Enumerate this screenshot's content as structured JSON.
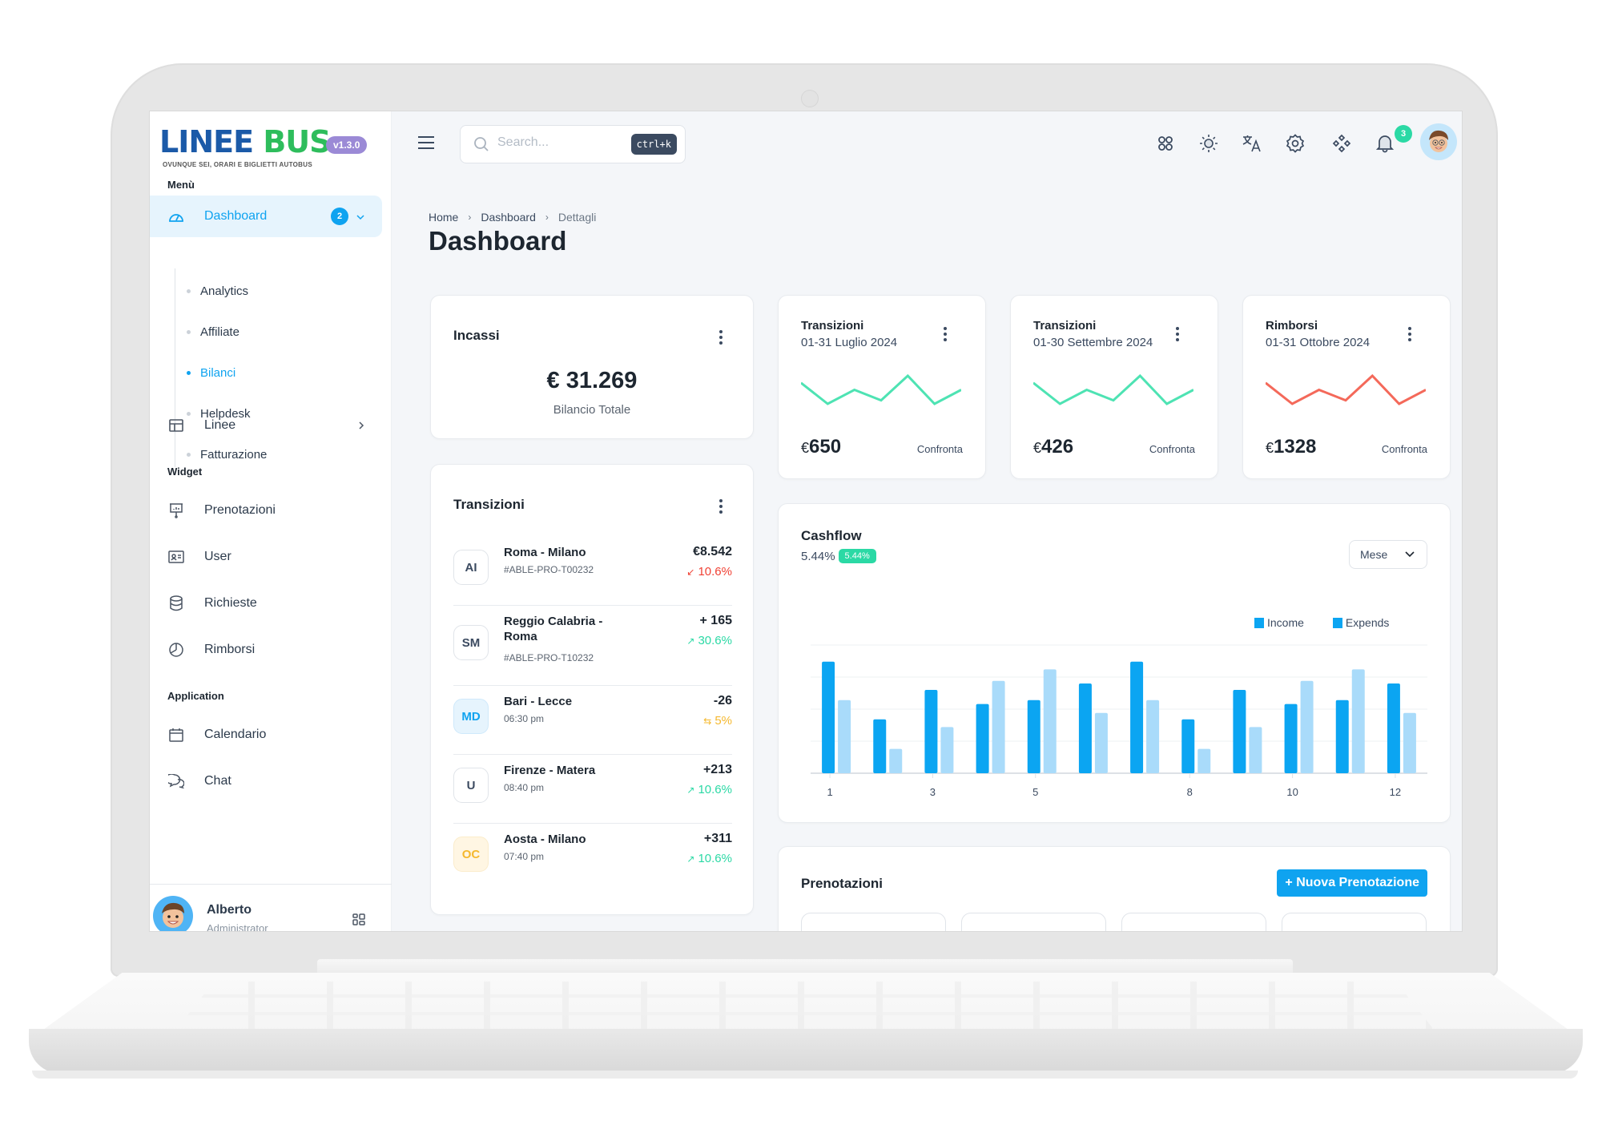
{
  "app": {
    "logo_main_1": "LINEE",
    "logo_main_2": "BUS",
    "logo_tagline": "OVUNQUE SEI, ORARI E BIGLIETTI AUTOBUS",
    "version": "v1.3.0"
  },
  "sidebar": {
    "sections": {
      "menu": "Menù",
      "widget": "Widget",
      "application": "Application"
    },
    "dashboard": {
      "label": "Dashboard",
      "badge": "2",
      "icon": "gauge-icon"
    },
    "dashboard_children": [
      {
        "label": "Analytics",
        "active": false
      },
      {
        "label": "Affiliate",
        "active": false
      },
      {
        "label": "Bilanci",
        "active": true
      },
      {
        "label": "Helpdesk",
        "active": false
      },
      {
        "label": "Fatturazione",
        "active": false
      }
    ],
    "linee": {
      "label": "Linee",
      "icon": "layout-icon"
    },
    "widget_items": [
      {
        "label": "Prenotazioni",
        "icon": "presentation-chart-icon"
      },
      {
        "label": "User",
        "icon": "id-card-icon"
      },
      {
        "label": "Richieste",
        "icon": "database-icon"
      },
      {
        "label": "Rimborsi",
        "icon": "pie-chart-icon"
      }
    ],
    "application_items": [
      {
        "label": "Calendario",
        "icon": "calendar-icon"
      },
      {
        "label": "Chat",
        "icon": "chat-icon"
      }
    ],
    "user": {
      "name": "Alberto",
      "role": "Administrator"
    }
  },
  "header": {
    "search_placeholder": "Search...",
    "search_shortcut": "ctrl+k",
    "icons": [
      "apps-icon",
      "sun-icon",
      "translate-icon",
      "settings-icon",
      "components-icon",
      "bell-icon"
    ],
    "notifications_count": "3"
  },
  "breadcrumb": [
    "Home",
    "Dashboard",
    "Dettagli"
  ],
  "page_title": "Dashboard",
  "incassi": {
    "title": "Incassi",
    "value": "€ 31.269",
    "subtitle": "Bilancio Totale"
  },
  "transactions": {
    "title": "Transizioni",
    "items": [
      {
        "initials": "AI",
        "route": "Roma - Milano",
        "sub": "#ABLE-PRO-T00232",
        "amount": "€8.542",
        "delta": "10.6%",
        "trend": "down",
        "trend_icon": "↙",
        "color": "#f04134",
        "avatar_style": "plain"
      },
      {
        "initials": "SM",
        "route": "Reggio Calabria - Roma",
        "sub": "#ABLE-PRO-T10232",
        "amount": "+ 165",
        "delta": "30.6%",
        "trend": "up",
        "trend_icon": "↗",
        "color": "#2bd9a5",
        "avatar_style": "plain"
      },
      {
        "initials": "MD",
        "route": "Bari - Lecce",
        "sub": "06:30 pm",
        "amount": "-26",
        "delta": "5%",
        "trend": "neutral",
        "trend_icon": "⇆",
        "color": "#f5b82e",
        "avatar_style": "blue"
      },
      {
        "initials": "U",
        "route": "Firenze - Matera",
        "sub": "08:40 pm",
        "amount": "+213",
        "delta": "10.6%",
        "trend": "up",
        "trend_icon": "↗",
        "color": "#2bd9a5",
        "avatar_style": "plain"
      },
      {
        "initials": "OC",
        "route": "Aosta - Milano",
        "sub": "07:40 pm",
        "amount": "+311",
        "delta": "10.6%",
        "trend": "up",
        "trend_icon": "↗",
        "color": "#2bd9a5",
        "avatar_style": "yellow"
      }
    ]
  },
  "mini_cards": [
    {
      "title": "Transizioni",
      "period": "01-31 Luglio 2024",
      "currency": "€",
      "value": "650",
      "compare": "Confronta",
      "color": "#4ee3b3",
      "spark": [
        5,
        2,
        4,
        2.5,
        6,
        2,
        4
      ]
    },
    {
      "title": "Transizioni",
      "period": "01-30 Settembre 2024",
      "currency": "€",
      "value": "426",
      "compare": "Confronta",
      "color": "#4ee3b3",
      "spark": [
        5,
        2,
        4,
        2.5,
        6,
        2,
        4
      ]
    },
    {
      "title": "Rimborsi",
      "period": "01-31 Ottobre 2024",
      "currency": "€",
      "value": "1328",
      "compare": "Confronta",
      "color": "#f4695a",
      "spark": [
        5,
        2,
        4,
        2.5,
        6,
        2,
        4
      ]
    }
  ],
  "cashflow": {
    "title": "Cashflow",
    "percent": "5.44%",
    "badge": "5.44%",
    "period_select": "Mese"
  },
  "prenotazioni": {
    "title": "Prenotazioni",
    "new_button": "+ Nuova Prenotazione"
  },
  "chart_data": {
    "type": "bar",
    "title": "Cashflow",
    "xlabel": "",
    "ylabel": "",
    "categories": [
      "1",
      "2",
      "3",
      "4",
      "5",
      "6",
      "7",
      "8",
      "9",
      "10",
      "11",
      "12"
    ],
    "tick_labels_shown": [
      "1",
      "3",
      "5",
      "8",
      "10",
      "12"
    ],
    "series": [
      {
        "name": "Income",
        "color": "#0ba5f2",
        "values": [
          87,
          42,
          65,
          54,
          57,
          70,
          87,
          42,
          65,
          54,
          57,
          70
        ]
      },
      {
        "name": "Expends",
        "color": "#a9dbfa",
        "values": [
          57,
          19,
          36,
          72,
          81,
          47,
          57,
          19,
          36,
          72,
          81,
          47
        ]
      }
    ],
    "ylim": [
      0,
      100
    ],
    "grid": true,
    "legend": "top-right"
  }
}
